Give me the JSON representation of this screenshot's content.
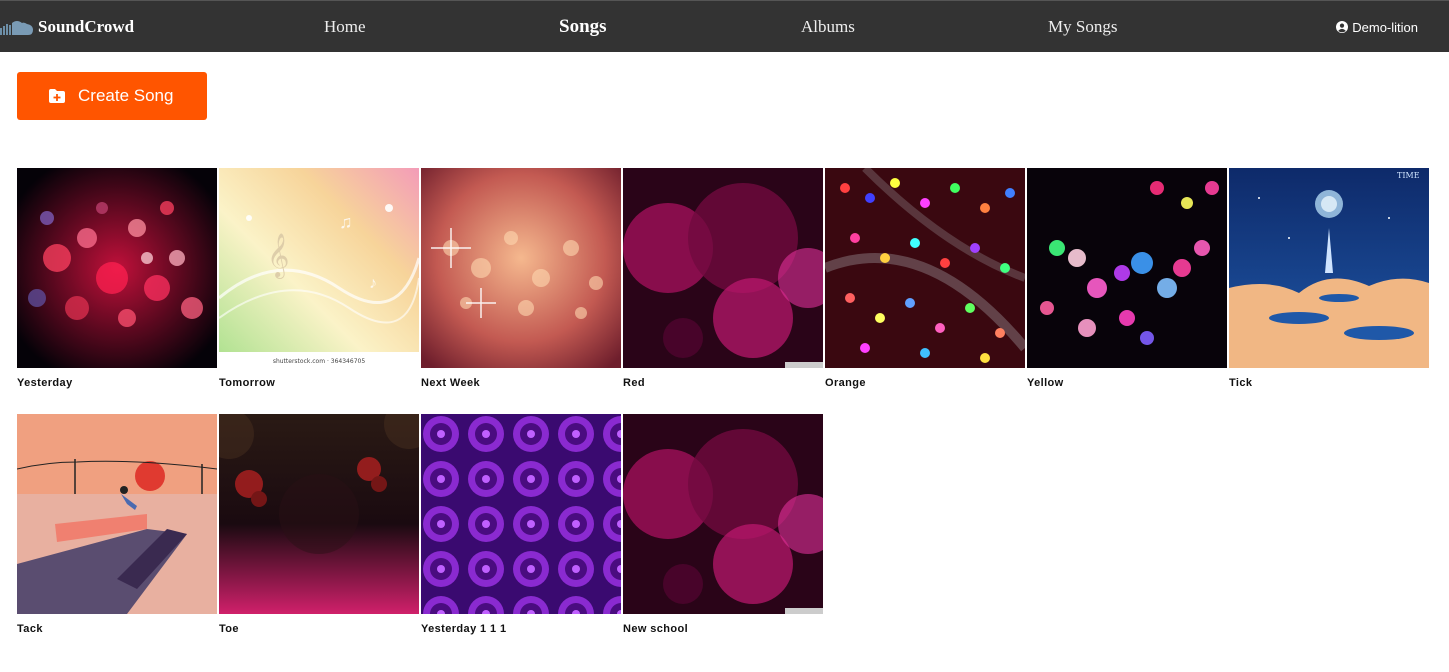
{
  "nav": {
    "brand": "SoundCrowd",
    "links": [
      "Home",
      "Songs",
      "Albums",
      "My Songs"
    ],
    "active": "Songs",
    "user": "Demo-lition"
  },
  "create_button": "Create Song",
  "songs": [
    {
      "title": "Yesterday",
      "art": "red-bokeh"
    },
    {
      "title": "Tomorrow",
      "art": "music-notes-pastel",
      "watermark": "shutterstock.com · 364346705"
    },
    {
      "title": "Next Week",
      "art": "warm-bokeh-sparkles"
    },
    {
      "title": "Red",
      "art": "magenta-bubbles"
    },
    {
      "title": "Orange",
      "art": "colorful-lights"
    },
    {
      "title": "Yellow",
      "art": "neon-bokeh"
    },
    {
      "title": "Tick",
      "art": "blue-album-cover",
      "cover_text": "TIME"
    },
    {
      "title": "Tack",
      "art": "sunset-illustration"
    },
    {
      "title": "Toe",
      "art": "grunge-red"
    },
    {
      "title": "Yesterday 1 1 1",
      "art": "purple-speakers"
    },
    {
      "title": "New school",
      "art": "magenta-bubbles"
    }
  ],
  "colors": {
    "navbar": "#333333",
    "accent": "#ff5500"
  }
}
